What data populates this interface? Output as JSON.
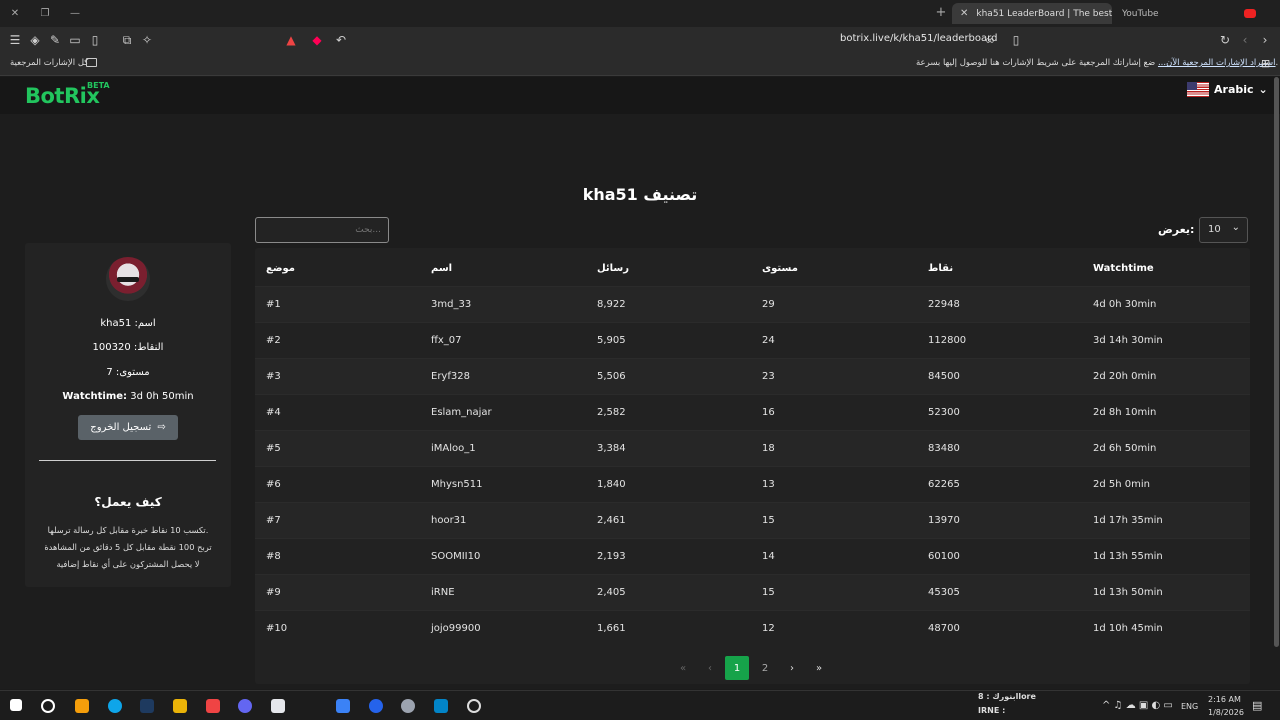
{
  "browser": {
    "active_tab": "kha51 LeaderBoard | The best Ch",
    "inactive_tab": "YouTube",
    "url": "botrix.live/k/kha51/leaderboard",
    "bookmarks_all": "كل الإشارات المرجعية",
    "bookmarks_hint": "ضع إشاراتك المرجعية على شريط الإشارات هنا للوصول إليها بسرعة.",
    "bookmarks_import": "استيراد الإشارات المرجعية الآن..."
  },
  "navbar": {
    "brand": "BotRix",
    "beta": "BETA",
    "language": "Arabic"
  },
  "page_title": "kha51 تصنيف",
  "search": {
    "placeholder": "بحث..."
  },
  "show": {
    "label": "يعرض:",
    "value": "10"
  },
  "profile": {
    "name": "kha51 :اسم",
    "points": "100320 :النقاط",
    "level": "7 :مستوى",
    "watchtime_label": "Watchtime:",
    "watchtime_value": " 3d 0h 50min",
    "logout": "تسجيل الخروج"
  },
  "how_it_works": {
    "title": "كيف يعمل؟",
    "lines": [
      "تكسب 10 نقاط خبرة مقابل كل رسالة ترسلها.",
      "تربح 100 نقطة مقابل كل 5 دقائق من المشاهدة",
      "لا يحصل المشتركون على أي نقاط إضافية"
    ]
  },
  "table": {
    "headers": [
      "موضع",
      "اسم",
      "رسائل",
      "مستوى",
      "نقاط",
      "Watchtime"
    ],
    "rows": [
      [
        "#1",
        "3md_33",
        "8,922",
        "29",
        "22948",
        "4d 0h 30min"
      ],
      [
        "#2",
        "ffx_07",
        "5,905",
        "24",
        "112800",
        "3d 14h 30min"
      ],
      [
        "#3",
        "Eryf328",
        "5,506",
        "23",
        "84500",
        "2d 20h 0min"
      ],
      [
        "#4",
        "Eslam_najar",
        "2,582",
        "16",
        "52300",
        "2d 8h 10min"
      ],
      [
        "#5",
        "iMAloo_1",
        "3,384",
        "18",
        "83480",
        "2d 6h 50min"
      ],
      [
        "#6",
        "Mhysn511",
        "1,840",
        "13",
        "62265",
        "2d 5h 0min"
      ],
      [
        "#7",
        "hoor31",
        "2,461",
        "15",
        "13970",
        "1d 17h 35min"
      ],
      [
        "#8",
        "SOOMII10",
        "2,193",
        "14",
        "60100",
        "1d 13h 55min"
      ],
      [
        "#9",
        "iRNE",
        "2,405",
        "15",
        "45305",
        "1d 13h 50min"
      ],
      [
        "#10",
        "jojo99900",
        "1,661",
        "12",
        "48700",
        "1d 10h 45min"
      ]
    ]
  },
  "pagination": {
    "first": "«",
    "prev": "‹",
    "pages": [
      "1",
      "2"
    ],
    "current": "1",
    "next": "›",
    "last": "»"
  },
  "taskbar": {
    "ticker_top": "بنورك : 8llore",
    "ticker_bottom": "IRNE :",
    "lang": "ENG",
    "time": "2:16 AM",
    "date": "1/8/2026"
  }
}
